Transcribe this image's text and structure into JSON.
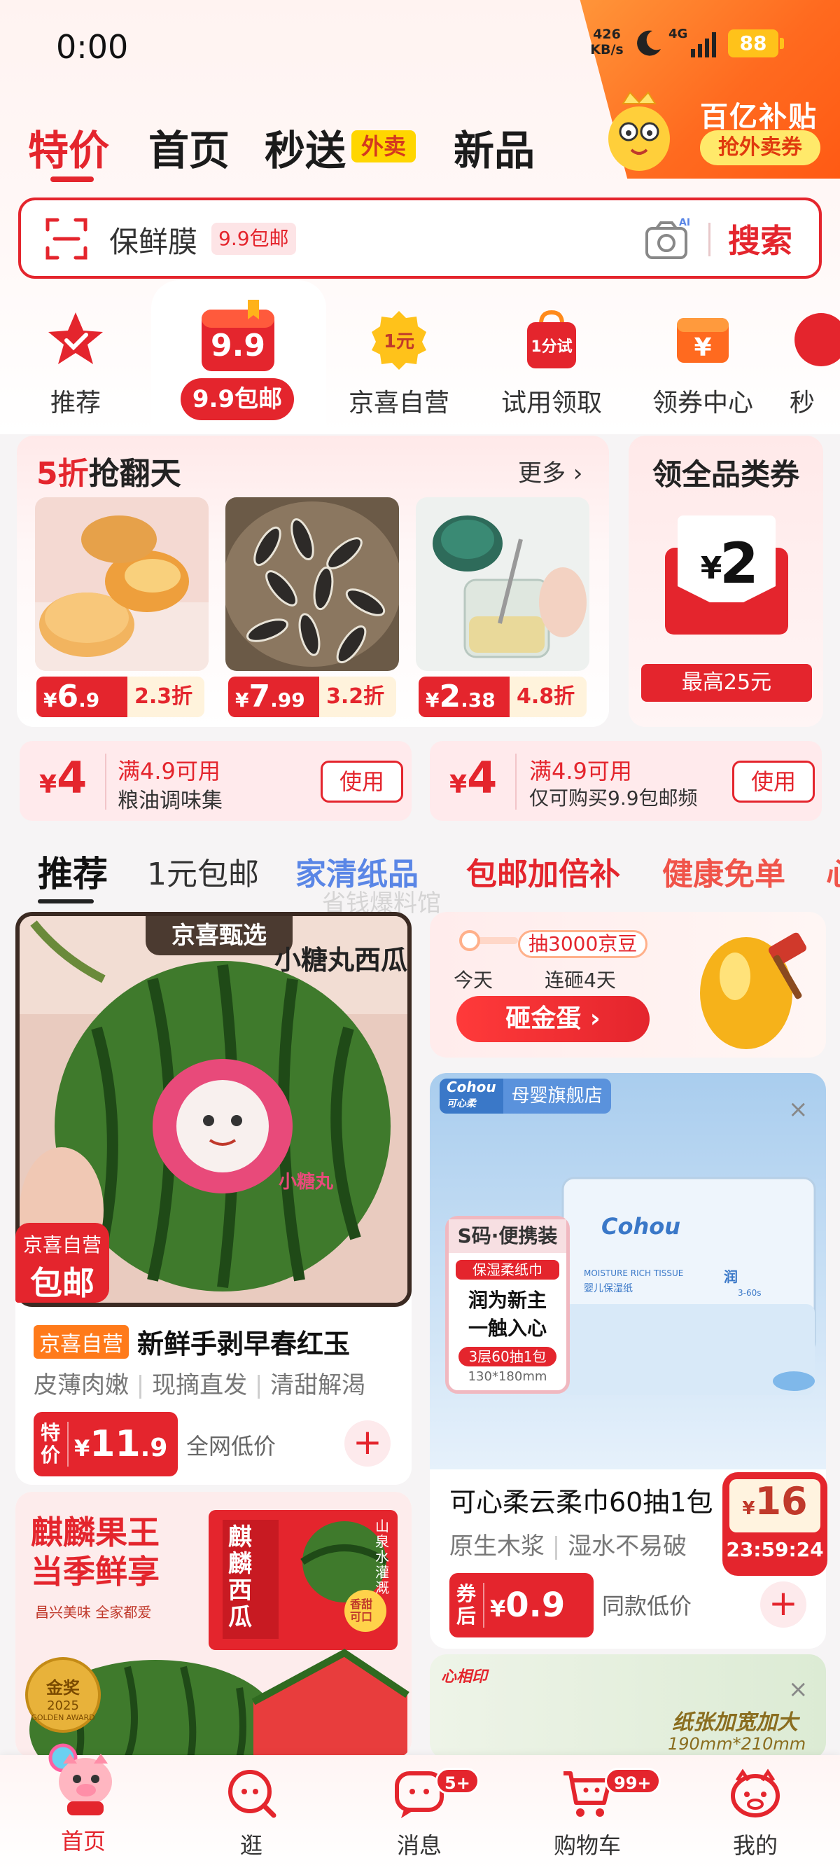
{
  "status": {
    "time": "0:00",
    "net_speed_value": "426",
    "net_speed_unit": "KB/s",
    "network": "4G",
    "battery": "88"
  },
  "promo_corner": {
    "title": "百亿补贴",
    "button": "抢外卖券"
  },
  "top_tabs": [
    {
      "label": "特价"
    },
    {
      "label": "首页"
    },
    {
      "label": "秒送"
    },
    {
      "label": "新品"
    }
  ],
  "waimai_badge": "外卖",
  "search": {
    "placeholder": "保鲜膜",
    "tag": "9.9包邮",
    "button": "搜索",
    "ai_label": "AI"
  },
  "categories": [
    {
      "label": "推荐",
      "icon": "star-check-icon"
    },
    {
      "label": "9.9包邮",
      "icon": "nine-nine-icon",
      "icon_text": "9.9"
    },
    {
      "label": "京喜自营",
      "icon": "one-yuan-coin-icon",
      "icon_text": "1元"
    },
    {
      "label": "试用领取",
      "icon": "trial-bag-icon",
      "icon_text": "1分试"
    },
    {
      "label": "领券中心",
      "icon": "coupon-yen-icon",
      "icon_text": "¥"
    },
    {
      "label": "秒",
      "icon": "partial-icon"
    }
  ],
  "flash_sale": {
    "title_red": "5折",
    "title_rest": "抢翻天",
    "more": "更多",
    "items": [
      {
        "price_yen": "¥",
        "price_int": "6",
        "price_dec": ".9",
        "discount": "2.3折"
      },
      {
        "price_yen": "¥",
        "price_int": "7",
        "price_dec": ".99",
        "discount": "3.2折"
      },
      {
        "price_yen": "¥",
        "price_int": "2",
        "price_dec": ".38",
        "discount": "4.8折"
      }
    ]
  },
  "category_coupon": {
    "title": "领全品类券",
    "amount_yen": "¥",
    "amount": "2",
    "max": "最高25元"
  },
  "mini_coupons": [
    {
      "yen": "¥",
      "amount": "4",
      "line1": "满4.9可用",
      "line2": "粮油调味集",
      "button": "使用"
    },
    {
      "yen": "¥",
      "amount": "4",
      "line1": "满4.9可用",
      "line2": "仅可购买9.9包邮频",
      "button": "使用"
    }
  ],
  "feed_tabs": [
    {
      "label": "推荐",
      "color": "#111111"
    },
    {
      "label": "1元包邮",
      "color": "#333333"
    },
    {
      "label": "家清纸品",
      "color": "#5a86e6"
    },
    {
      "label": "包邮加倍补",
      "color": "#e4252d"
    },
    {
      "label": "健康免单",
      "color": "#f0544a"
    },
    {
      "label": "心",
      "color": "#f0544a"
    }
  ],
  "watermark": "省钱爆料馆",
  "product_watermelon": {
    "badge_top": "京喜甄选",
    "image_caption": "小糖丸西瓜",
    "badge_left_line1": "京喜自营",
    "badge_left_line2": "包邮",
    "image_text": "小糖丸",
    "tag": "京喜自营",
    "title": "新鲜手剥早春红玉",
    "features": [
      "皮薄肉嫩",
      "现摘直发",
      "清甜解渴"
    ],
    "price_label_top": "特",
    "price_label_bottom": "价",
    "price_yen": "¥",
    "price": "11",
    "price_dec": ".9",
    "price_note": "全网低价",
    "plus": "+"
  },
  "golden_egg": {
    "progress_label": "抽3000京豆",
    "today": "今天",
    "streak": "连砸4天",
    "button": "砸金蛋"
  },
  "product_wipes": {
    "store_badge": "母婴旗舰店",
    "brand": "Cohou",
    "brand_cn": "可心柔",
    "box_label": "S码·便携装",
    "box_line1": "保湿柔纸巾",
    "box_line2": "润为新主",
    "box_line3": "一触入心",
    "box_pack": "3层60抽1包",
    "box_size": "130*180mm",
    "pack_english": "MOISTURE RICH TISSUE",
    "pack_cn": "婴儿保湿纸",
    "pack_side": "润",
    "pack_count": "3-60s",
    "title": "可心柔云柔巾60抽1包",
    "features": [
      "原生木浆",
      "湿水不易破"
    ],
    "price_label_top": "券",
    "price_label_bottom": "后",
    "price_yen": "¥",
    "price": "0.9",
    "price_note": "同款低价",
    "timer_yen": "¥",
    "timer_amount": "16",
    "timer": "23:59:24",
    "plus": "+",
    "close": "×"
  },
  "product_kylin": {
    "headline_line1": "麒麟果王",
    "headline_line2": "当季鲜享",
    "sub": "昌兴美味 全家都爱",
    "box_title": "麒麟西瓜",
    "box_side": "山泉水灌溉",
    "box_sticker": "香甜可口",
    "medal_line1": "金奖",
    "medal_year": "2025",
    "medal_line2": "GOLDEN AWARD"
  },
  "product_tissue": {
    "brand": "心相印",
    "headline": "纸张加宽加大",
    "size": "190mm*210mm",
    "close": "×"
  },
  "bottom_nav": [
    {
      "label": "首页",
      "icon": "home-pig-icon",
      "badge": ""
    },
    {
      "label": "逛",
      "icon": "browse-icon",
      "badge": ""
    },
    {
      "label": "消息",
      "icon": "message-icon",
      "badge": "5+"
    },
    {
      "label": "购物车",
      "icon": "cart-icon",
      "badge": "99+"
    },
    {
      "label": "我的",
      "icon": "profile-pig-icon",
      "badge": ""
    }
  ],
  "colors": {
    "accent": "#e4252d",
    "orange": "#ff6a1f",
    "gold": "#ffc21a"
  }
}
